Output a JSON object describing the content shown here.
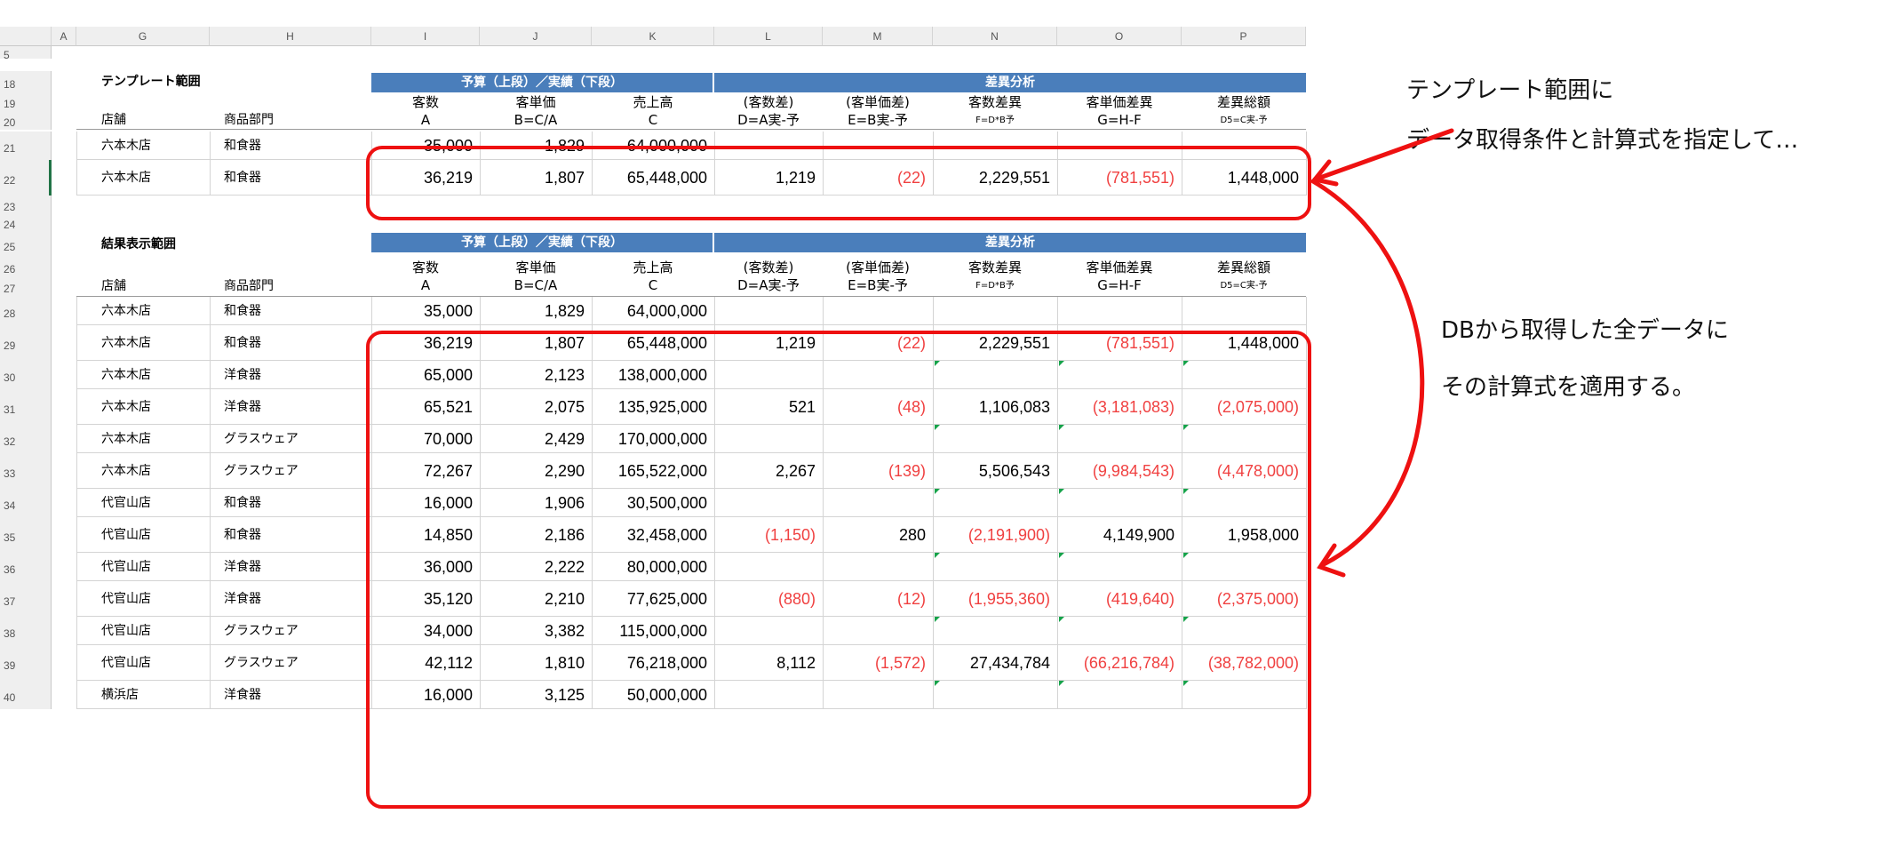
{
  "columns": [
    "A",
    "G",
    "H",
    "I",
    "J",
    "K",
    "L",
    "M",
    "N",
    "O",
    "P"
  ],
  "row_numbers": [
    "5",
    "18",
    "19",
    "20",
    "21",
    "22",
    "23",
    "24",
    "25",
    "26",
    "27",
    "28",
    "29",
    "30",
    "31",
    "32",
    "33",
    "34",
    "35",
    "36",
    "37",
    "38",
    "39",
    "40"
  ],
  "template": {
    "title": "テンプレート範囲",
    "store_hdr": "店舗",
    "dept_hdr": "商品部門",
    "group1": "予算（上段）／実績（下段）",
    "group2": "差異分析",
    "cols": [
      {
        "l1": "客数",
        "l2": "A"
      },
      {
        "l1": "客単価",
        "l2": "B=C/A"
      },
      {
        "l1": "売上高",
        "l2": "C"
      },
      {
        "l1": "(客数差)",
        "l2": "D=A実-予"
      },
      {
        "l1": "(客単価差)",
        "l2": "E=B実-予"
      },
      {
        "l1": "客数差異",
        "l2": "F=D*B予"
      },
      {
        "l1": "客単価差異",
        "l2": "G=H-F"
      },
      {
        "l1": "差異総額",
        "l2": "D5=C実-予"
      }
    ],
    "rows": [
      {
        "store": "六本木店",
        "dept": "和食器",
        "v": [
          "35,000",
          "1,829",
          "64,000,000",
          "",
          "",
          "",
          "",
          ""
        ]
      },
      {
        "store": "六本木店",
        "dept": "和食器",
        "v": [
          "36,219",
          "1,807",
          "65,448,000",
          "1,219",
          "(22)",
          "2,229,551",
          "(781,551)",
          "1,448,000"
        ]
      }
    ]
  },
  "result": {
    "title": "結果表示範囲",
    "store_hdr": "店舗",
    "dept_hdr": "商品部門",
    "group1": "予算（上段）／実績（下段）",
    "group2": "差異分析",
    "cols": [
      {
        "l1": "客数",
        "l2": "A"
      },
      {
        "l1": "客単価",
        "l2": "B=C/A"
      },
      {
        "l1": "売上高",
        "l2": "C"
      },
      {
        "l1": "(客数差)",
        "l2": "D=A実-予"
      },
      {
        "l1": "(客単価差)",
        "l2": "E=B実-予"
      },
      {
        "l1": "客数差異",
        "l2": "F=D*B予"
      },
      {
        "l1": "客単価差異",
        "l2": "G=H-F"
      },
      {
        "l1": "差異総額",
        "l2": "D5=C実-予"
      }
    ],
    "rows": [
      {
        "store": "六本木店",
        "dept": "和食器",
        "v": [
          "35,000",
          "1,829",
          "64,000,000",
          "",
          "",
          "",
          "",
          ""
        ]
      },
      {
        "store": "六本木店",
        "dept": "和食器",
        "v": [
          "36,219",
          "1,807",
          "65,448,000",
          "1,219",
          "(22)",
          "2,229,551",
          "(781,551)",
          "1,448,000"
        ]
      },
      {
        "store": "六本木店",
        "dept": "洋食器",
        "v": [
          "65,000",
          "2,123",
          "138,000,000",
          "",
          "",
          "",
          "",
          ""
        ]
      },
      {
        "store": "六本木店",
        "dept": "洋食器",
        "v": [
          "65,521",
          "2,075",
          "135,925,000",
          "521",
          "(48)",
          "1,106,083",
          "(3,181,083)",
          "(2,075,000)"
        ]
      },
      {
        "store": "六本木店",
        "dept": "グラスウェア",
        "v": [
          "70,000",
          "2,429",
          "170,000,000",
          "",
          "",
          "",
          "",
          ""
        ]
      },
      {
        "store": "六本木店",
        "dept": "グラスウェア",
        "v": [
          "72,267",
          "2,290",
          "165,522,000",
          "2,267",
          "(139)",
          "5,506,543",
          "(9,984,543)",
          "(4,478,000)"
        ]
      },
      {
        "store": "代官山店",
        "dept": "和食器",
        "v": [
          "16,000",
          "1,906",
          "30,500,000",
          "",
          "",
          "",
          "",
          ""
        ]
      },
      {
        "store": "代官山店",
        "dept": "和食器",
        "v": [
          "14,850",
          "2,186",
          "32,458,000",
          "(1,150)",
          "280",
          "(2,191,900)",
          "4,149,900",
          "1,958,000"
        ]
      },
      {
        "store": "代官山店",
        "dept": "洋食器",
        "v": [
          "36,000",
          "2,222",
          "80,000,000",
          "",
          "",
          "",
          "",
          ""
        ]
      },
      {
        "store": "代官山店",
        "dept": "洋食器",
        "v": [
          "35,120",
          "2,210",
          "77,625,000",
          "(880)",
          "(12)",
          "(1,955,360)",
          "(419,640)",
          "(2,375,000)"
        ]
      },
      {
        "store": "代官山店",
        "dept": "グラスウェア",
        "v": [
          "34,000",
          "3,382",
          "115,000,000",
          "",
          "",
          "",
          "",
          ""
        ]
      },
      {
        "store": "代官山店",
        "dept": "グラスウェア",
        "v": [
          "42,112",
          "1,810",
          "76,218,000",
          "8,112",
          "(1,572)",
          "27,434,784",
          "(66,216,784)",
          "(38,782,000)"
        ]
      },
      {
        "store": "横浜店",
        "dept": "洋食器",
        "v": [
          "16,000",
          "3,125",
          "50,000,000",
          "",
          "",
          "",
          "",
          ""
        ]
      }
    ]
  },
  "annotations": {
    "note1_line1": "テンプレート範囲に",
    "note1_line2": "データ取得条件と計算式を指定して…",
    "note2_line1": "DBから取得した全データに",
    "note2_line2": "その計算式を適用する。"
  },
  "colors": {
    "header_blue": "#4a7ebb",
    "negative_red": "#f04040",
    "highlight_red": "#ee1111",
    "indicator_green": "#16a34a"
  }
}
